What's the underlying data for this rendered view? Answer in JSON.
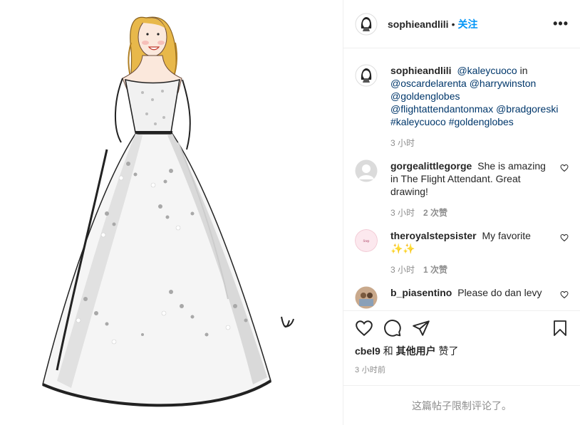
{
  "post": {
    "author": "sophieandlili",
    "separator": "•",
    "follow_label": "关注",
    "more_label": "•••"
  },
  "caption": {
    "username": "sophieandlili",
    "text_before": " ",
    "mentions": [
      "@kaleycuoco",
      "in",
      "@oscardelarenta",
      "@harrywinston",
      "@goldenglobes",
      "@flightattendantonmax",
      "@bradgoreski",
      "#kaleycuoco",
      "#goldenglobes"
    ],
    "time": "3 小时"
  },
  "comments": [
    {
      "username": "gorgealittlegorge",
      "text": "She is amazing in The Flight Attendant. Great drawing!",
      "time": "3 小时",
      "likes": "2 次赞"
    },
    {
      "username": "theroyalstepsister",
      "text": "My favorite ✨✨",
      "time": "3 小时",
      "likes": "1 次赞"
    },
    {
      "username": "b_piasentino",
      "text": "Please do dan levy",
      "time": "",
      "likes": ""
    }
  ],
  "likes": {
    "user": "cbel9",
    "joiner": " 和 ",
    "others": "其他用户",
    "suffix": " 赞了"
  },
  "posted_ago": "3 小时前",
  "comments_disabled": "这篇帖子限制评论了。",
  "icons": [
    "heart-icon",
    "comment-icon",
    "share-icon",
    "save-icon"
  ],
  "colors": {
    "link": "#00376b",
    "follow": "#0095f6",
    "muted": "#8e8e8e"
  }
}
